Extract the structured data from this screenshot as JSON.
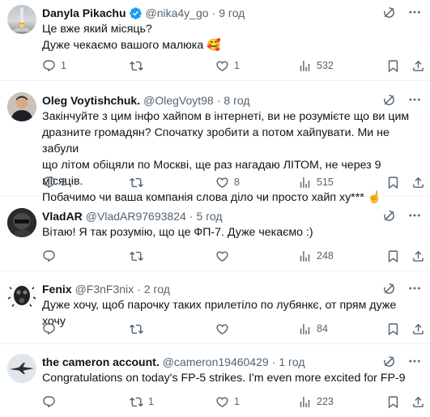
{
  "tweets": [
    {
      "name": "Danyla Pikachu",
      "handle": "@nika4y_go",
      "dot": "·",
      "time": "9 год",
      "verified": true,
      "lines": [
        "Це вже який місяць?",
        "Дуже чекаємо вашого малюка 🥰"
      ],
      "replies": "1",
      "retweets": "",
      "likes": "1",
      "views": "532"
    },
    {
      "name": "Oleg Voytishchuk.",
      "handle": "@OlegVoyt98",
      "dot": "·",
      "time": "8 год",
      "verified": false,
      "lines": [
        "Закінчуйте з цим інфо хайпом в інтернеті, ви не розумієте що ви цим",
        "дразните громадян? Спочатку зробити а потом хайпувати. Ми не забули",
        "що літом обіцяли по Москві, ще раз нагадаю ЛІТОМ, не через 9 місяців.",
        "Побачимо чи ваша компанія слова діло чи просто хайп ху*** ☝️"
      ],
      "replies": "2",
      "retweets": "",
      "likes": "8",
      "views": "515"
    },
    {
      "name": "VladAR",
      "handle": "@VladAR97693824",
      "dot": "·",
      "time": "5 год",
      "verified": false,
      "lines": [
        "Вітаю! Я так розумію, що це ФП-7. Дуже чекаємо :)"
      ],
      "replies": "",
      "retweets": "",
      "likes": "",
      "views": "248"
    },
    {
      "name": "Fenix",
      "handle": "@F3nF3nix",
      "dot": "·",
      "time": "2 год",
      "verified": false,
      "lines": [
        "Дуже хочу, щоб парочку таких прилетіло по лубянкє, от прям дуже хочу"
      ],
      "replies": "",
      "retweets": "",
      "likes": "",
      "views": "84"
    },
    {
      "name": "the cameron account.",
      "handle": "@cameron19460429",
      "dot": "·",
      "time": "1 год",
      "verified": false,
      "lines": [
        "Congratulations on today's FP-5 strikes. I'm even more excited for FP-9"
      ],
      "replies": "",
      "retweets": "1",
      "likes": "1",
      "views": "223"
    }
  ],
  "colors": {
    "text": "#0f1419",
    "muted": "#536471",
    "verified": "#1d9bf0",
    "divider": "#eff3f4"
  },
  "icons": [
    "reply-icon",
    "retweet-icon",
    "like-icon",
    "views-icon",
    "bookmark-icon",
    "share-icon",
    "grok-icon",
    "more-icon",
    "verified-icon"
  ]
}
